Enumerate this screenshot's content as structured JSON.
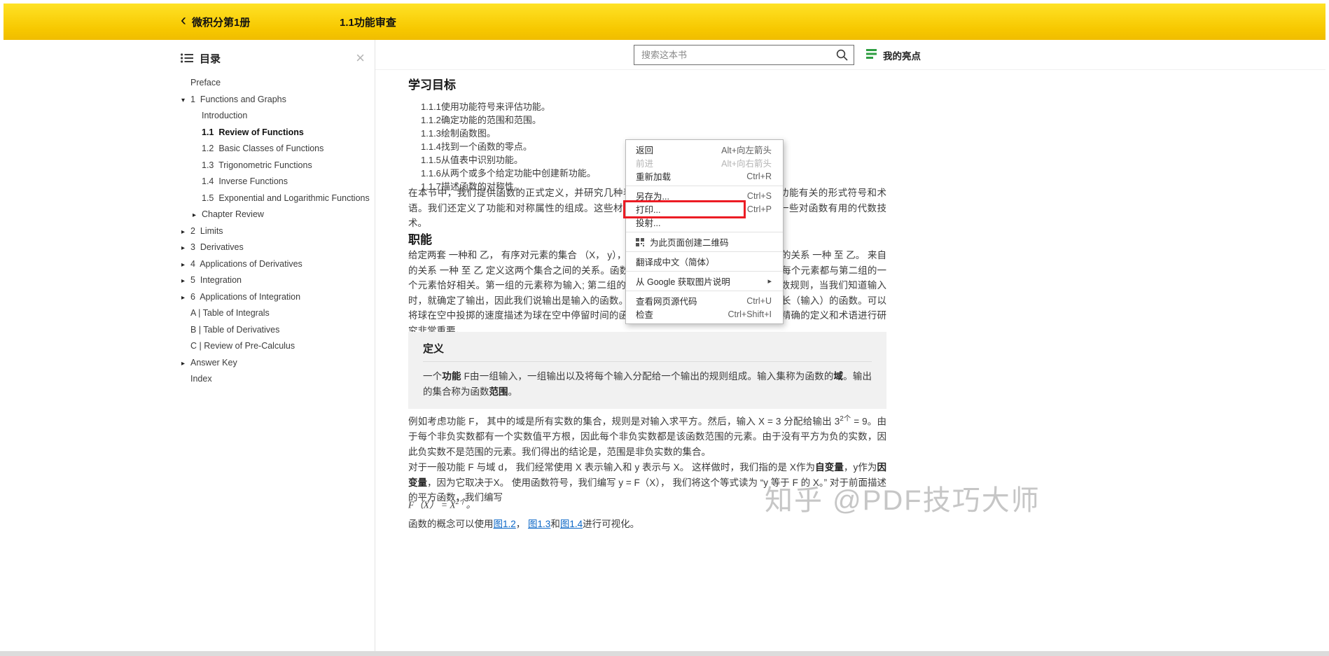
{
  "icons": {
    "back": "‹",
    "close": "×",
    "tri_down": "▾",
    "tri_right": "▸",
    "submenu": "▸"
  },
  "header": {
    "book_title": "微积分第1册",
    "page_title": "1.1功能审查"
  },
  "toolbar": {
    "search_placeholder": "搜索这本书",
    "highlights_label": "我的亮点"
  },
  "sidebar": {
    "title": "目录",
    "items": [
      {
        "label": "Preface"
      },
      {
        "label": "1  Functions and Graphs",
        "state": "expanded"
      },
      {
        "label": "Introduction"
      },
      {
        "label": "1.1  Review of Functions",
        "state": "current"
      },
      {
        "label": "1.2  Basic Classes of Functions"
      },
      {
        "label": "1.3  Trigonometric Functions"
      },
      {
        "label": "1.4  Inverse Functions"
      },
      {
        "label": "1.5  Exponential and Logarithmic Functions"
      },
      {
        "label": "Chapter Review",
        "state": "collapsed"
      },
      {
        "label": "2  Limits",
        "state": "collapsed"
      },
      {
        "label": "3  Derivatives",
        "state": "collapsed"
      },
      {
        "label": "4  Applications of Derivatives",
        "state": "collapsed"
      },
      {
        "label": "5  Integration",
        "state": "collapsed"
      },
      {
        "label": "6  Applications of Integration",
        "state": "collapsed"
      },
      {
        "label": "A | Table of Integrals"
      },
      {
        "label": "B | Table of Derivatives"
      },
      {
        "label": "C | Review of Pre-Calculus"
      },
      {
        "label": "Answer Key",
        "state": "collapsed"
      },
      {
        "label": "Index"
      }
    ]
  },
  "content": {
    "objectives_title": "学习目标",
    "objectives": [
      "1.1.1使用功能符号来评估功能。",
      "1.1.2确定功能的范围和范围。",
      "1.1.3绘制函数图。",
      "1.1.4找到一个函数的零点。",
      "1.1.5从值表中识别功能。",
      "1.1.6从两个或多个给定功能中创建新功能。",
      "1.1.7描述函数的对称性。"
    ],
    "intro": "在本节中，我们提供函数的正式定义，并研究几种表示函数的方法。然后，我们学习与功能有关的形式符号和术语。我们还定义了功能和对称属性的组成。这些材料中的大部分将是复习，但会提醒您一些对函数有用的代数技术。",
    "functions_title": "职能",
    "functions_text": "给定两套 一种和 乙， 有序对元素的集合 （X， y）， 在哪里 X ∈ 一种 和 y ∈ 乙 称为来自的关系 一种 至 乙。 来自的关系 一种 至 乙 定义这两个集合之间的关系。函数是一种特殊的关系，其中第一组中的每个元素都与第二组的一个元素恰好相关。第一组的元素称为输入; 第二组的元素称为输出。在数学中一直使用函数规则，当我们知道输入时，就确定了输出，因此我们说输出是输入的函数。例如，正方形的面积（输出）是其边长（输入）的函数。可以将球在空中投掷的速度描述为球在空中停留时间的函数。由于功能有许多用途，因此具有精确的定义和术语进行研究非常重要。",
    "definition": {
      "title": "定义",
      "parts": [
        "一个",
        "功能",
        " F由一组输入，一组输出以及将每个输入分配给一个输出的规则组成。输入集称为函数的",
        "域",
        "。输出的集合称为函数",
        "范围",
        "。"
      ]
    },
    "example": {
      "before_sup": "例如考虑功能 F， 其中的域是所有实数的集合，规则是对输入求平方。然后，输入 X = 3 分配给输出 3",
      "sup": "2个",
      "after_sup": " = 9。由于每个非负实数都有一个实数值平方根，因此每个非负实数都是该函数范围的元素。由于没有平方为负的实数，因此负实数不是范围的元素。我们得出的结论是，范围是非负实数的集合。"
    },
    "general": {
      "parts": [
        "对于一般功能 F 与域 d， 我们经常使用 X 表示输入和 y 表示与 X。 这样做时，我们指的是 X作为",
        "自变量",
        "，y作为",
        "因变量",
        "，因为它取决于X。 使用函数符号，我们编写 y = F（X）， 我们将这个等式读为 “y 等于 F 的 X。” 对于前面描述的平方函数，我们编写"
      ]
    },
    "formula": {
      "base": "F（X） = X",
      "sup": "2个",
      "tail": "。"
    },
    "figures": {
      "prefix": "函数的概念可以使用",
      "link1": "图1.2",
      "sep1": "， ",
      "link2": "图1.3",
      "sep2": "和",
      "link3": "图1.4",
      "suffix": "进行可视化。"
    }
  },
  "context_menu": {
    "items": [
      {
        "label": "返回",
        "shortcut": "Alt+向左箭头"
      },
      {
        "label": "前进",
        "shortcut": "Alt+向右箭头",
        "disabled": true
      },
      {
        "label": "重新加载",
        "shortcut": "Ctrl+R"
      },
      {
        "label": "另存为...",
        "shortcut": "Ctrl+S"
      },
      {
        "label": "打印...",
        "shortcut": "Ctrl+P",
        "annotated": true
      },
      {
        "label": "投射...",
        "shortcut": ""
      },
      {
        "label": "为此页面创建二维码",
        "shortcut": ""
      },
      {
        "label": "翻译成中文（简体）",
        "shortcut": ""
      },
      {
        "label": "从 Google 获取图片说明",
        "shortcut": "",
        "submenu": true
      },
      {
        "label": "查看网页源代码",
        "shortcut": "Ctrl+U"
      },
      {
        "label": "检查",
        "shortcut": "Ctrl+Shift+I"
      }
    ]
  },
  "watermark": "知乎 @PDF技巧大师"
}
